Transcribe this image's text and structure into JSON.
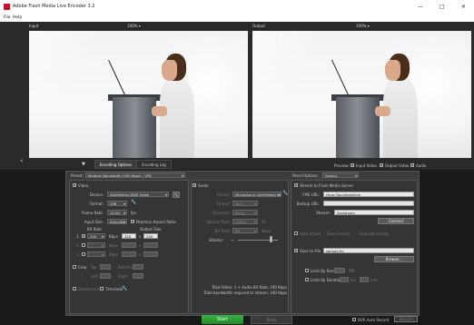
{
  "window": {
    "title": "Adobe Flash Media Live Encoder 3.2",
    "minimize": "—",
    "maximize": "□",
    "close": "✕"
  },
  "menu": {
    "file": "File",
    "help": "Help"
  },
  "preview": {
    "input_label": "Input",
    "input_zoom": "100% ▾",
    "output_label": "Output",
    "output_zoom": "100% ▾",
    "side_marker": "◂|"
  },
  "tabs": {
    "encoding_options": "Encoding Options",
    "encoding_log": "Encoding Log",
    "collapse": "▼"
  },
  "preview_toggles": {
    "label": "Preview:",
    "input_video": "Input Video",
    "output_video": "Output Video",
    "audio": "Audio"
  },
  "preset": {
    "label": "Preset:",
    "value": "Medium Bandwidth (300 Kbps) - VP6"
  },
  "video": {
    "header": "Video",
    "device_label": "Device:",
    "device_value": "AVerMedia HDMI Video",
    "format_label": "Format:",
    "format_value": "VP6",
    "frame_rate_label": "Frame Rate:",
    "frame_rate_value": "15.00",
    "fps": "fps",
    "input_size_label": "Input Size:",
    "input_size_value": "640x360",
    "maintain_aspect": "Maintain Aspect Ratio",
    "bit_rate_label": "Bit Rate",
    "output_size_label": "Output Size",
    "row1_index": "1.",
    "row1_bitrate": "200",
    "row1_unit": "Kbps",
    "row1_w": "320",
    "row1_x": "x",
    "row1_h": "240",
    "row2_index": "2.",
    "row2_unit": "Kbps",
    "row2_x": "x",
    "row3_index": "3.",
    "row3_unit": "Kbps",
    "row3_x": "x",
    "crop_label": "Crop",
    "crop_top": "Top",
    "crop_bottom": "Bottom",
    "crop_left": "Left",
    "crop_right": "Right",
    "deinterlace": "Deinterlace",
    "timecode": "Timecode"
  },
  "audio": {
    "header": "Audio",
    "device_label": "Device:",
    "device_value": "Microphone (AVerMedia HDMI Audio)",
    "format_label": "Format:",
    "format_value": "Mp3",
    "channels_label": "Channels:",
    "channels_value": "Mono",
    "sample_rate_label": "Sample Rate:",
    "sample_rate_value": "22050",
    "hz": "Hz",
    "bit_rate_label": "Bit Rate:",
    "bit_rate_value": "56",
    "kbps": "Kbps",
    "volume_label": "Volume:",
    "volume_min": "—",
    "volume_level": 0.85
  },
  "totals": {
    "total_line": "Total Video: 1 + Audio Bit Rate:  240 Kbps",
    "total_bandwidth": "Total bandwidth required to stream:  240 Kbps"
  },
  "output_panel": {
    "panel_options_label": "Panel Options:",
    "panel_options_value": "Output",
    "stream_to_fms": "Stream to Flash Media Server",
    "fms_url_label": "FMS URL:",
    "fms_url_value": "rtmp://localhost/live",
    "backup_url_label": "Backup URL:",
    "stream_label": "Stream:",
    "stream_value": "livestream",
    "connect_button": "Connect",
    "auto_adjust": "Auto Adjust",
    "drop_frames": "Drop Frames",
    "degrade_quality": "Degrade Quality",
    "save_to_file": "Save to File",
    "file_value": "sample.flv",
    "browse_button": "Browse...",
    "limit_by_size": "Limit By Size",
    "mb": "MB",
    "limit_by_duration": "Limit By Duration",
    "hrs": "hrs",
    "min": "min"
  },
  "controls": {
    "start": "Start",
    "stop": "Stop",
    "dvr_auto_record": "DVR Auto Record",
    "record_button": "Record"
  }
}
